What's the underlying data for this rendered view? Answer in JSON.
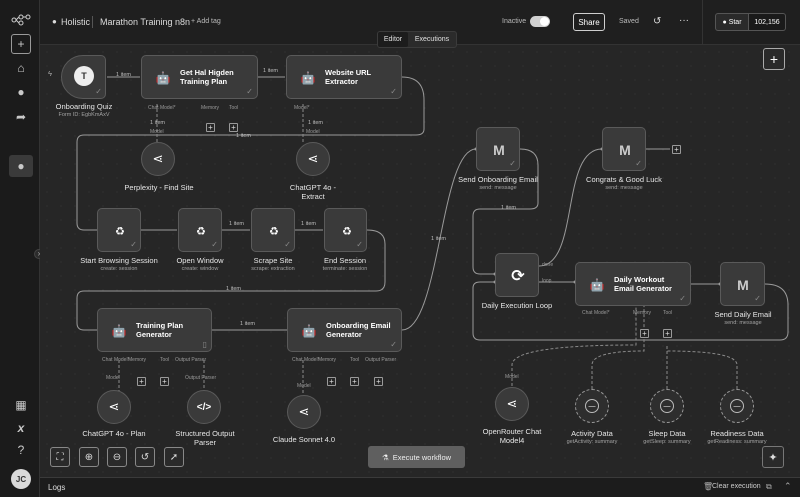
{
  "header": {
    "project": "Holistic",
    "workflow_name": "Marathon Training n8n",
    "add_tag": "+ Add tag",
    "active_label": "Inactive",
    "share": "Share",
    "saved": "Saved",
    "star": "Star",
    "star_count": "102,156"
  },
  "tabs": {
    "editor": "Editor",
    "executions": "Executions"
  },
  "nodes": {
    "onboarding_quiz": {
      "title": "Onboarding Quiz",
      "sub": "Form ID: EgbKmAxV",
      "icon": "T"
    },
    "hal_higden": {
      "title": "Get Hal Higden Training Plan"
    },
    "website_extractor": {
      "title": "Website URL Extractor"
    },
    "perplexity": {
      "title": "Perplexity - Find Site"
    },
    "gpt4o_extract": {
      "title": "ChatGPT 4o - Extract"
    },
    "start_browsing": {
      "title": "Start Browsing Session",
      "sub": "create: session"
    },
    "open_window": {
      "title": "Open Window",
      "sub": "create: window"
    },
    "scrape_site": {
      "title": "Scrape Site",
      "sub": "scrape: extraction"
    },
    "end_session": {
      "title": "End Session",
      "sub": "terminate: session"
    },
    "training_plan_gen": {
      "title": "Training Plan Generator"
    },
    "onboarding_email_gen": {
      "title": "Onboarding Email Generator"
    },
    "gpt4o_plan": {
      "title": "ChatGPT 4o - Plan"
    },
    "structured_parser": {
      "title": "Structured Output Parser"
    },
    "claude_sonnet": {
      "title": "Claude Sonnet 4.0"
    },
    "send_onboarding": {
      "title": "Send Onboarding Email",
      "sub": "send: message"
    },
    "congrats": {
      "title": "Congrats & Good Luck",
      "sub": "send: message"
    },
    "daily_loop": {
      "title": "Daily Execution Loop"
    },
    "daily_workout_gen": {
      "title": "Daily Workout Email Generator"
    },
    "send_daily": {
      "title": "Send Daily Email",
      "sub": "send: message"
    },
    "openrouter": {
      "title": "OpenRouter Chat Model4"
    },
    "activity": {
      "title": "Activity Data",
      "sub": "getActivity: summary"
    },
    "sleep": {
      "title": "Sleep Data",
      "sub": "getSleep: summary"
    },
    "readiness": {
      "title": "Readiness Data",
      "sub": "getReadiness: summary"
    }
  },
  "ports": {
    "chat_model": "Chat Model*",
    "memory": "Memory",
    "tool": "Tool",
    "model_req": "Model*",
    "model": "Model",
    "output_parser": "Output Parser",
    "done": "done",
    "loop": "loop"
  },
  "edge_labels": {
    "one_item": "1 item"
  },
  "execute_label": "Execute workflow",
  "logs": {
    "label": "Logs",
    "clear": "Clear execution"
  },
  "avatar_initials": "JC"
}
